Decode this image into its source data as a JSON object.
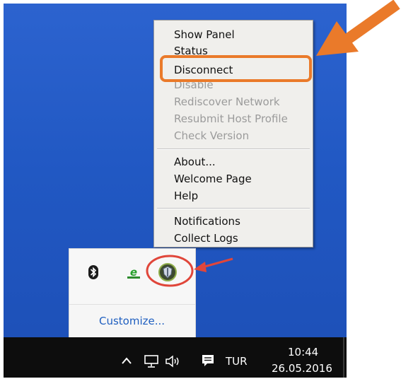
{
  "context_menu": {
    "items": [
      {
        "label": "Show Panel",
        "enabled": true
      },
      {
        "label": "Status",
        "enabled": true
      },
      {
        "label": "Disconnect",
        "enabled": true
      },
      {
        "label": "Disable",
        "enabled": false
      },
      {
        "label": "Rediscover Network",
        "enabled": false
      },
      {
        "label": "Resubmit Host Profile",
        "enabled": false
      },
      {
        "label": "Check Version",
        "enabled": false
      },
      {
        "label": "About...",
        "enabled": true
      },
      {
        "label": "Welcome Page",
        "enabled": true
      },
      {
        "label": "Help",
        "enabled": true
      },
      {
        "label": "Notifications",
        "enabled": true
      },
      {
        "label": "Collect Logs",
        "enabled": true
      }
    ]
  },
  "tray_flyout": {
    "icons": [
      "bluetooth-icon",
      "green-e-icon",
      "vpn-shield-icon"
    ],
    "customize_label": "Customize..."
  },
  "taskbar": {
    "language": "TUR",
    "time": "10:44",
    "date": "26.05.2016"
  },
  "annotations": {
    "highlight_color": "#ea7a2a",
    "tray_circle_color": "#e0463a"
  }
}
